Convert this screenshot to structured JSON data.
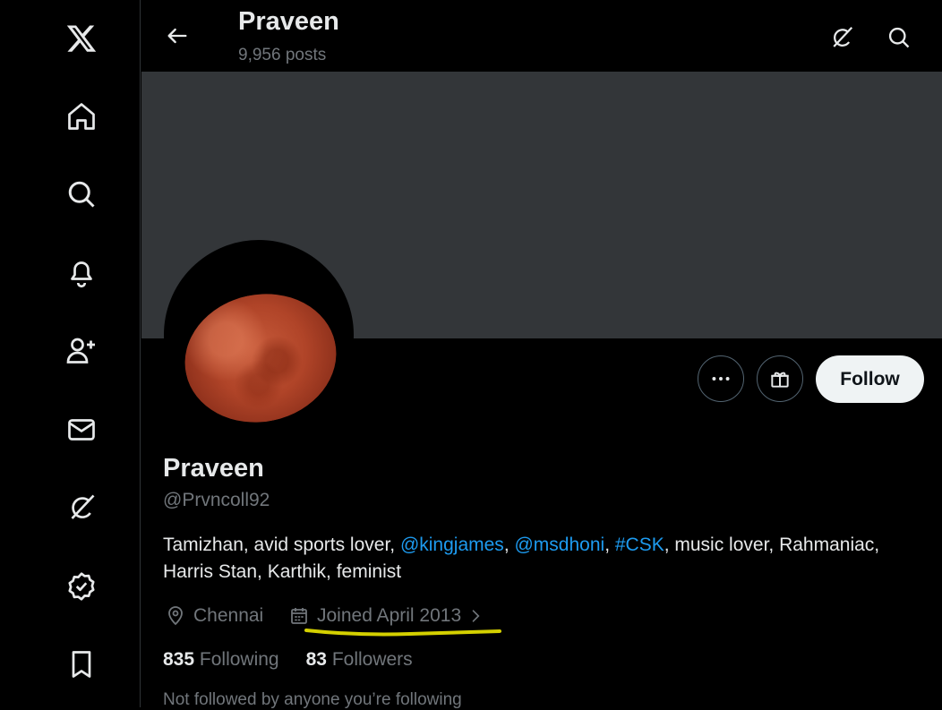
{
  "header": {
    "name": "Praveen",
    "posts": "9,956 posts"
  },
  "sidebar": {
    "icons": [
      "x-logo-icon",
      "home-icon",
      "search-icon",
      "bell-icon",
      "person-add-icon",
      "mail-icon",
      "grok-icon",
      "verified-icon",
      "bookmark-icon"
    ]
  },
  "profile": {
    "name": "Praveen",
    "handle": "@Prvncoll92",
    "bio": {
      "part1": "Tamizhan, avid sports lover, ",
      "mention1": "@kingjames",
      "sep1": ", ",
      "mention2": "@msdhoni",
      "sep2": ", ",
      "hashtag": "#CSK",
      "part2": ", music lover, Rahmaniac, Harris Stan, Karthik, feminist"
    },
    "location": "Chennai",
    "joined": "Joined April 2013",
    "following_count": "835",
    "following_label": "Following",
    "followers_count": "83",
    "followers_label": "Followers",
    "not_followed": "Not followed by anyone you’re following"
  },
  "actions": {
    "follow_label": "Follow"
  },
  "colors": {
    "link": "#1d9bf0",
    "banner": "#333639",
    "highlight": "#d4d000"
  }
}
